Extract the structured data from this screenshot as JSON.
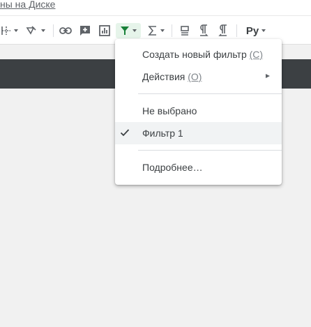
{
  "topbar": {
    "drive_link_text": "ны на Диске"
  },
  "toolbar": {
    "icons": [
      "borders-icon",
      "fill-color-icon",
      "insert-link-icon",
      "insert-comment-icon",
      "insert-chart-icon",
      "filter-icon",
      "functions-icon",
      "text-direction-icon",
      "text-ltr-icon",
      "text-rtl-icon",
      "input-tools-icon"
    ],
    "input_tools_label": "Ру",
    "active_color": "#188038"
  },
  "filter_menu": {
    "create_filter": {
      "label": "Создать новый фильтр ",
      "shortcut": "(С)"
    },
    "actions": {
      "label": "Действия ",
      "shortcut": "(О)"
    },
    "none_selected": "Не выбрано",
    "filter_1": "Фильтр 1",
    "more_info": "Подробнее…"
  },
  "colors": {
    "dark_bar": "#3c4043",
    "menu_selected_bg": "#f1f3f4",
    "sheet_bg": "#f1f1f1"
  }
}
